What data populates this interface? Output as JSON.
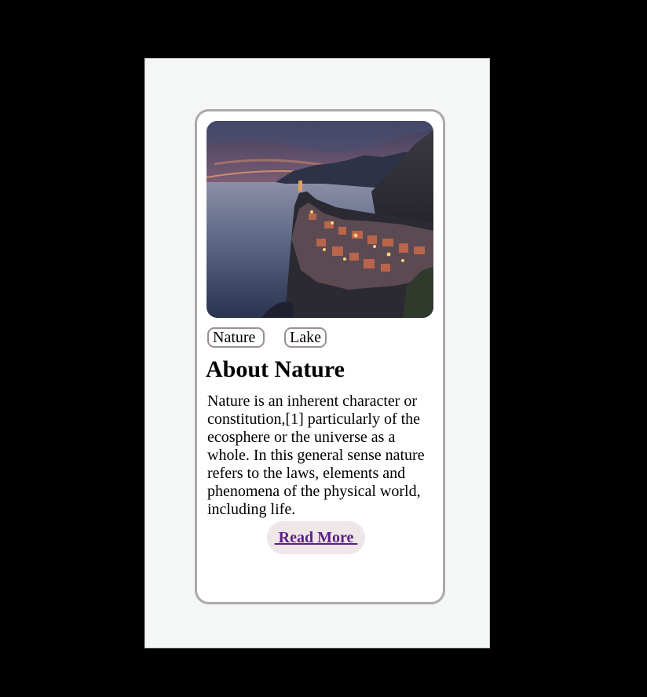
{
  "card": {
    "image": {
      "subject": "coastal-village-sunset"
    },
    "tags": [
      "Nature",
      "Lake"
    ],
    "title": "About Nature",
    "description": "Nature is an inherent character or constitution,[1] particularly of the ecosphere or the universe as a whole. In this general sense nature refers to the laws, elements and phenomena of the physical world, including life.",
    "button_label": " Read More "
  },
  "colors": {
    "page_background": "#000000",
    "frame_background": "#f4f7f6",
    "card_border": "#aaaaaa",
    "tag_border": "#9b8f8f",
    "button_background": "#efe6e8",
    "button_text": "#5b1e86"
  }
}
